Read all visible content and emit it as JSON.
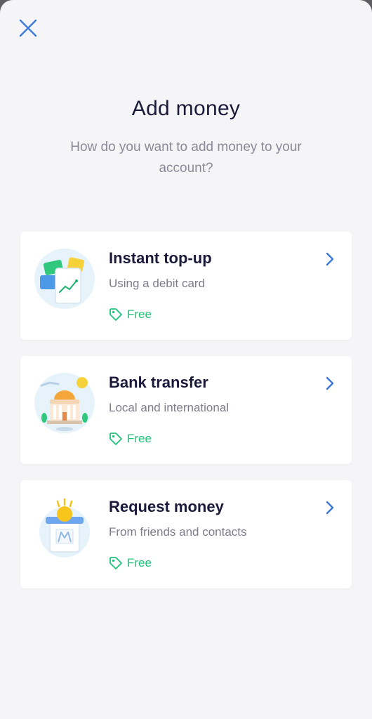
{
  "header": {
    "title": "Add money",
    "subtitle": "How do you want to add money to your account?",
    "close_icon": "close-icon"
  },
  "options": [
    {
      "title": "Instant top-up",
      "subtitle": "Using a debit card",
      "price": "Free",
      "icon": "debit-cards-illustration"
    },
    {
      "title": "Bank transfer",
      "subtitle": "Local and international",
      "price": "Free",
      "icon": "bank-building-illustration"
    },
    {
      "title": "Request money",
      "subtitle": "From friends and contacts",
      "price": "Free",
      "icon": "coin-jar-illustration"
    }
  ],
  "colors": {
    "accent": "#2f6fd1",
    "free_green": "#1fc37a",
    "text_dark": "#1b1a3a",
    "text_muted": "#8b8a99",
    "background": "#f5f5f7"
  }
}
